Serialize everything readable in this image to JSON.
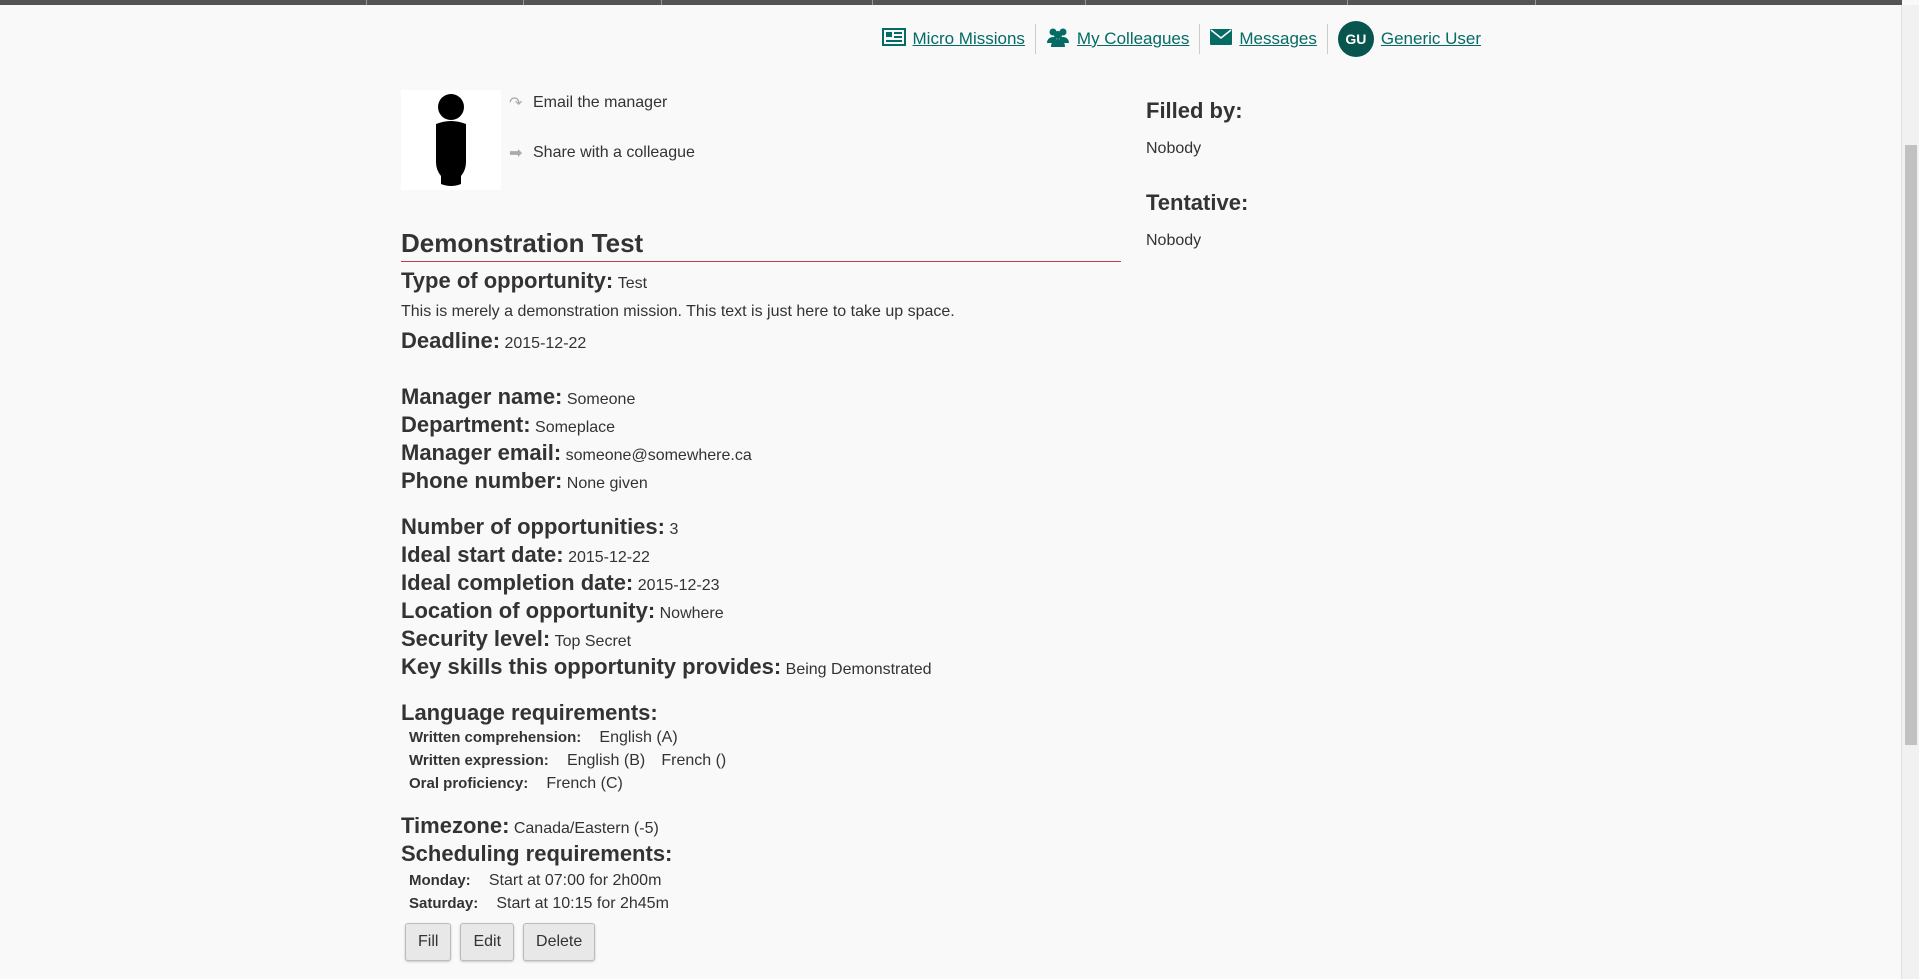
{
  "nav": {
    "micro_missions": "Micro Missions",
    "my_colleagues": "My Colleagues",
    "messages": "Messages",
    "avatar_initials": "GU",
    "user_name": "Generic User"
  },
  "actions": {
    "email_manager": "Email the manager",
    "share_colleague": "Share with a colleague"
  },
  "mission": {
    "title": "Demonstration Test",
    "type_label": "Type of opportunity:",
    "type_value": "Test",
    "description": "This is merely a demonstration mission. This text is just here to take up space.",
    "deadline_label": "Deadline:",
    "deadline_value": "2015-12-22",
    "manager_name_label": "Manager name:",
    "manager_name_value": "Someone",
    "department_label": "Department:",
    "department_value": "Someplace",
    "manager_email_label": "Manager email:",
    "manager_email_value": "someone@somewhere.ca",
    "phone_label": "Phone number:",
    "phone_value": "None given",
    "num_opps_label": "Number of opportunities:",
    "num_opps_value": "3",
    "start_label": "Ideal start date:",
    "start_value": "2015-12-22",
    "completion_label": "Ideal completion date:",
    "completion_value": "2015-12-23",
    "location_label": "Location of opportunity:",
    "location_value": "Nowhere",
    "security_label": "Security level:",
    "security_value": "Top Secret",
    "skills_label": "Key skills this opportunity provides:",
    "skills_value": "Being Demonstrated",
    "language_label": "Language requirements:",
    "written_comp_label": "Written comprehension:",
    "written_comp_values": [
      "English (A)"
    ],
    "written_expr_label": "Written expression:",
    "written_expr_values": [
      "English (B)",
      "French ()"
    ],
    "oral_label": "Oral proficiency:",
    "oral_values": [
      "French (C)"
    ],
    "timezone_label": "Timezone:",
    "timezone_value": "Canada/Eastern (-5)",
    "scheduling_label": "Scheduling requirements:",
    "schedule": [
      {
        "day": "Monday:",
        "text": "Start at 07:00 for 2h00m"
      },
      {
        "day": "Saturday:",
        "text": "Start at 10:15 for 2h45m"
      }
    ]
  },
  "buttons": {
    "fill": "Fill",
    "edit": "Edit",
    "delete": "Delete"
  },
  "side": {
    "filled_by_label": "Filled by:",
    "filled_by_value": "Nobody",
    "tentative_label": "Tentative:",
    "tentative_value": "Nobody"
  }
}
